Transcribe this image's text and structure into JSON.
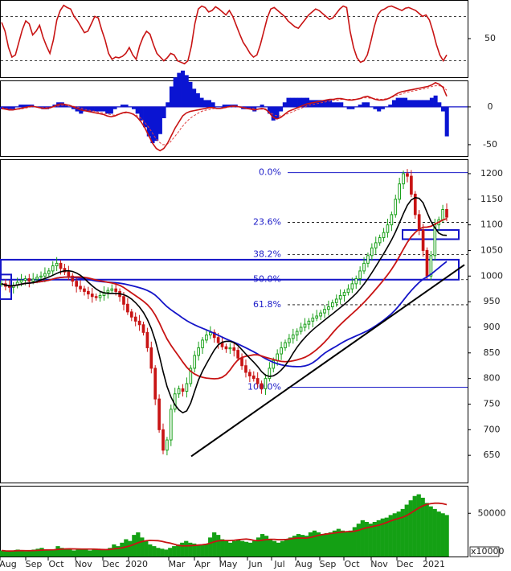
{
  "chart_data": [
    {
      "type": "line",
      "panel": "stochastic",
      "ylim": [
        0,
        100
      ],
      "y_ticks": [
        50
      ],
      "reference_levels": [
        80,
        20
      ],
      "series": [
        {
          "values": [
            72,
            60,
            38,
            25,
            28,
            45,
            62,
            74,
            70,
            55,
            60,
            68,
            52,
            40,
            30,
            48,
            75,
            88,
            95,
            92,
            90,
            80,
            74,
            66,
            58,
            60,
            70,
            80,
            78,
            62,
            48,
            30,
            22,
            25,
            24,
            26,
            30,
            38,
            28,
            22,
            40,
            52,
            60,
            56,
            42,
            30,
            25,
            20,
            24,
            30,
            28,
            20,
            18,
            16,
            20,
            40,
            70,
            90,
            94,
            92,
            86,
            88,
            93,
            90,
            86,
            82,
            88,
            80,
            68,
            56,
            45,
            38,
            30,
            25,
            28,
            42,
            60,
            78,
            90,
            92,
            88,
            84,
            80,
            74,
            70,
            66,
            64,
            70,
            76,
            82,
            86,
            90,
            88,
            84,
            80,
            76,
            78,
            84,
            90,
            94,
            92,
            60,
            38,
            24,
            18,
            20,
            28,
            46,
            66,
            82,
            88,
            90,
            93,
            94,
            92,
            90,
            88,
            91,
            92,
            90,
            88,
            84,
            80,
            82,
            75,
            60,
            42,
            28,
            20,
            28
          ]
        }
      ]
    },
    {
      "type": "line",
      "panel": "macd",
      "ylim": [
        -65,
        35
      ],
      "y_ticks": [
        0,
        -50
      ],
      "series": [
        {
          "values": [
            -2,
            -3,
            -4,
            -4,
            -3,
            -2,
            -1,
            0,
            1,
            0,
            -1,
            -2,
            -2,
            -1,
            1,
            3,
            4,
            3,
            2,
            0,
            -2,
            -4,
            -5,
            -6,
            -7,
            -8,
            -9,
            -10,
            -12,
            -13,
            -12,
            -10,
            -8,
            -7,
            -8,
            -10,
            -14,
            -20,
            -28,
            -38,
            -48,
            -55,
            -58,
            -55,
            -48,
            -38,
            -28,
            -20,
            -12,
            -8,
            -6,
            -5,
            -4,
            -3,
            -2,
            -1,
            -1,
            -2,
            -2,
            -1,
            0,
            1,
            1,
            0,
            -1,
            -2,
            -3,
            -4,
            -3,
            -2,
            -3,
            -8,
            -14,
            -16,
            -14,
            -10,
            -6,
            -4,
            -2,
            0,
            2,
            4,
            5,
            6,
            7,
            8,
            9,
            10,
            10,
            11,
            11,
            10,
            9,
            9,
            10,
            11,
            13,
            14,
            12,
            10,
            9,
            9,
            10,
            12,
            15,
            18,
            20,
            21,
            22,
            23,
            24,
            25,
            26,
            27,
            29,
            32,
            30,
            26,
            14
          ]
        },
        {
          "values": [
            -1,
            -2,
            -3,
            -3,
            -3,
            -3,
            -2,
            -1,
            0,
            0,
            -1,
            -1,
            -1,
            -1,
            0,
            1,
            2,
            2,
            2,
            1,
            0,
            -1,
            -3,
            -4,
            -5,
            -6,
            -7,
            -8,
            -9,
            -10,
            -11,
            -10,
            -9,
            -8,
            -8,
            -9,
            -11,
            -14,
            -19,
            -25,
            -32,
            -40,
            -46,
            -50,
            -50,
            -47,
            -41,
            -35,
            -28,
            -22,
            -17,
            -13,
            -10,
            -7,
            -5,
            -4,
            -3,
            -2,
            -2,
            -2,
            -1,
            0,
            0,
            0,
            0,
            -1,
            -2,
            -2,
            -3,
            -3,
            -3,
            -5,
            -8,
            -11,
            -12,
            -12,
            -10,
            -8,
            -6,
            -4,
            -2,
            0,
            2,
            3,
            4,
            5,
            6,
            7,
            8,
            9,
            9,
            10,
            10,
            10,
            10,
            10,
            11,
            12,
            12,
            11,
            11,
            10,
            10,
            11,
            12,
            14,
            16,
            17,
            19,
            20,
            21,
            22,
            23,
            24,
            25,
            27,
            28,
            28,
            27,
            22
          ]
        }
      ]
    },
    {
      "type": "candlestick",
      "panel": "price",
      "ylim": [
        600,
        1225
      ],
      "y_ticks": [
        650,
        700,
        750,
        800,
        850,
        900,
        950,
        1000,
        1050,
        1100,
        1150,
        1200
      ],
      "x_ticks": [
        "Aug",
        "Sep",
        "Oct",
        "Nov",
        "Dec",
        "2020",
        "Mar",
        "Apr",
        "May",
        "Jun",
        "Jul",
        "Aug",
        "Sep",
        "Oct",
        "Nov",
        "Dec",
        "2021"
      ],
      "volume_axis_label": "x10000",
      "fibonacci_levels": [
        {
          "label": "0.0%",
          "value": 1202
        },
        {
          "label": "23.6%",
          "value": 1105
        },
        {
          "label": "38.2%",
          "value": 1042
        },
        {
          "label": "50.0%",
          "value": 993
        },
        {
          "label": "61.8%",
          "value": 944
        },
        {
          "label": "100.0%",
          "value": 783
        }
      ],
      "close": [
        985,
        980,
        978,
        982,
        988,
        992,
        995,
        990,
        994,
        998,
        1000,
        1005,
        1010,
        1020,
        1025,
        1015,
        1008,
        1000,
        990,
        980,
        975,
        970,
        965,
        960,
        958,
        962,
        968,
        972,
        975,
        970,
        960,
        945,
        930,
        920,
        912,
        905,
        890,
        860,
        820,
        760,
        700,
        660,
        680,
        740,
        770,
        780,
        775,
        790,
        820,
        845,
        860,
        875,
        885,
        890,
        880,
        870,
        862,
        858,
        860,
        855,
        840,
        825,
        812,
        805,
        800,
        790,
        780,
        800,
        820,
        835,
        848,
        860,
        870,
        878,
        885,
        892,
        900,
        906,
        912,
        918,
        922,
        928,
        935,
        940,
        948,
        955,
        962,
        968,
        975,
        985,
        995,
        1010,
        1025,
        1040,
        1055,
        1065,
        1075,
        1085,
        1100,
        1120,
        1150,
        1180,
        1200,
        1195,
        1160,
        1120,
        1090,
        1050,
        1000,
        1040,
        1100,
        1110,
        1130,
        1115
      ],
      "volume": [
        7,
        6,
        6,
        7,
        8,
        7,
        6,
        7,
        8,
        9,
        10,
        8,
        7,
        8,
        12,
        10,
        9,
        8,
        7,
        8,
        9,
        8,
        7,
        8,
        9,
        8,
        8,
        10,
        14,
        12,
        16,
        20,
        18,
        25,
        28,
        22,
        18,
        14,
        12,
        10,
        9,
        8,
        10,
        12,
        14,
        16,
        18,
        16,
        15,
        14,
        13,
        14,
        22,
        28,
        25,
        20,
        18,
        16,
        18,
        20,
        18,
        17,
        16,
        18,
        22,
        26,
        24,
        20,
        18,
        16,
        18,
        20,
        22,
        24,
        26,
        25,
        24,
        28,
        30,
        28,
        26,
        27,
        28,
        30,
        32,
        30,
        28,
        30,
        34,
        38,
        42,
        40,
        38,
        40,
        42,
        44,
        45,
        48,
        50,
        52,
        55,
        60,
        65,
        70,
        72,
        68,
        62,
        58,
        55,
        52,
        50,
        48
      ]
    }
  ]
}
